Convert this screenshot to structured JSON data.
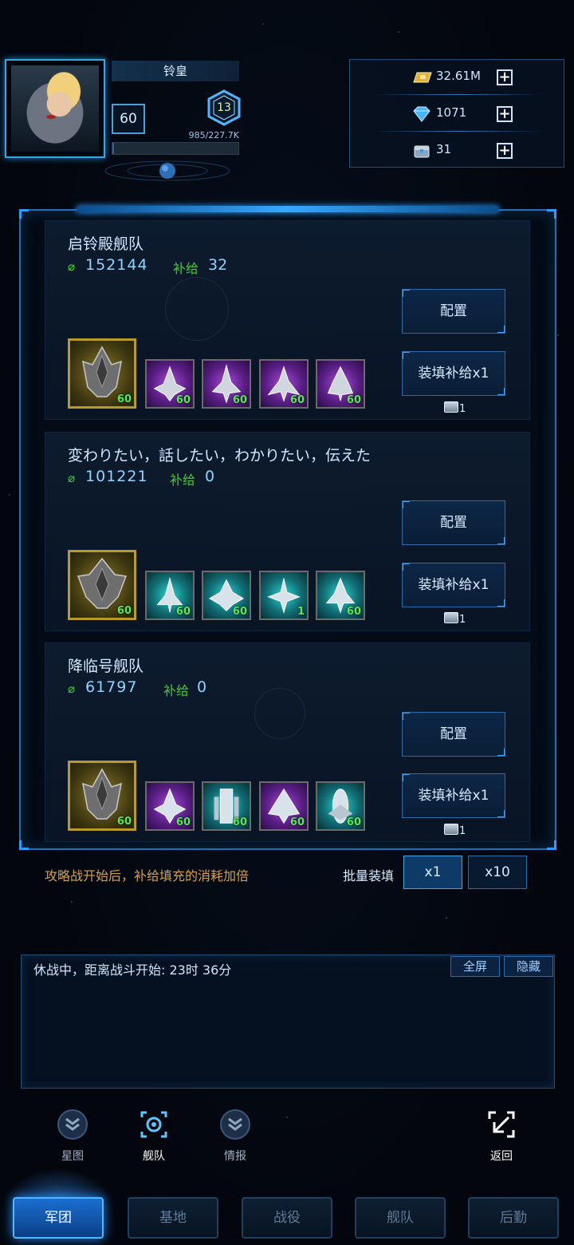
{
  "player": {
    "name": "铃皇",
    "level": "60",
    "rank": "13",
    "exp": "985/227.7K",
    "exp_progress": 0.0043
  },
  "resources": [
    {
      "icon": "gold-bar-icon",
      "value": "32.61M"
    },
    {
      "icon": "diamond-icon",
      "value": "1071"
    },
    {
      "icon": "supply-chest-icon",
      "value": "31"
    }
  ],
  "fleets": [
    {
      "name": "启铃殿舰队",
      "power": "152144",
      "supply_label": "补给",
      "supply": "32",
      "config_label": "配置",
      "refill_label": "装填补给x1",
      "chest_count": "1",
      "flagship_level": "60",
      "ships": [
        {
          "rarity": "purple",
          "level": "60"
        },
        {
          "rarity": "purple",
          "level": "60"
        },
        {
          "rarity": "purple",
          "level": "60"
        },
        {
          "rarity": "purple",
          "level": "60"
        }
      ]
    },
    {
      "name": "変わりたい，話したい，わかりたい，伝えた",
      "power": "101221",
      "supply_label": "补给",
      "supply": "0",
      "config_label": "配置",
      "refill_label": "装填补给x1",
      "chest_count": "1",
      "flagship_level": "60",
      "ships": [
        {
          "rarity": "teal",
          "level": "60"
        },
        {
          "rarity": "teal",
          "level": "60"
        },
        {
          "rarity": "teal",
          "level": "1"
        },
        {
          "rarity": "teal",
          "level": "60"
        }
      ]
    },
    {
      "name": "降临号舰队",
      "power": "61797",
      "supply_label": "补给",
      "supply": "0",
      "config_label": "配置",
      "refill_label": "装填补给x1",
      "chest_count": "1",
      "flagship_level": "60",
      "ships": [
        {
          "rarity": "purple",
          "level": "60"
        },
        {
          "rarity": "teal",
          "level": "60"
        },
        {
          "rarity": "purple",
          "level": "60"
        },
        {
          "rarity": "teal",
          "level": "60"
        }
      ]
    }
  ],
  "batch": {
    "notice": "攻略战开始后，补给填充的消耗加倍",
    "label": "批量装填",
    "options": [
      "x1",
      "x10"
    ],
    "selected": "x1"
  },
  "chat": {
    "status": "休战中，距离战斗开始: 23时 36分",
    "fullscreen_label": "全屏",
    "hide_label": "隐藏"
  },
  "subnav": [
    {
      "label": "星图",
      "icon": "chevron-shield-icon",
      "active": false
    },
    {
      "label": "舰队",
      "icon": "fleet-target-icon",
      "active": true
    },
    {
      "label": "情报",
      "icon": "chevron-shield-icon",
      "active": false
    },
    {
      "label": "返回",
      "icon": "return-arrow-icon",
      "active": false
    }
  ],
  "tabs": [
    {
      "label": "军团",
      "active": true
    },
    {
      "label": "基地",
      "active": false
    },
    {
      "label": "战役",
      "active": false
    },
    {
      "label": "舰队",
      "active": false
    },
    {
      "label": "后勤",
      "active": false
    }
  ],
  "colors": {
    "accent": "#37a8ff",
    "power_icon": "#3ed43e",
    "supply_label": "#46c83a",
    "level_text": "#56e856",
    "notice": "#d6a04a"
  }
}
